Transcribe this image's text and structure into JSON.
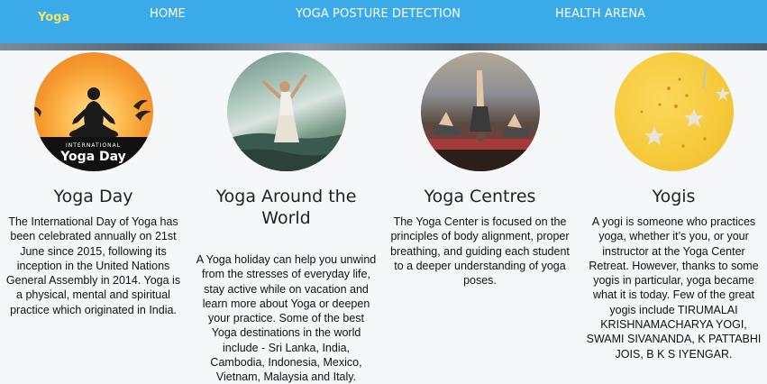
{
  "nav": {
    "brand": "Yoga",
    "links": [
      "HOME",
      "YOGA POSTURE DETECTION",
      "HEALTH ARENA"
    ]
  },
  "cards": [
    {
      "title": "Yoga Day",
      "image_icon": "yoga-day-image",
      "image_text_small": "INTERNATIONAL",
      "image_text_large": "Yoga Day",
      "text": "The International Day of Yoga has been celebrated annually on 21st June since 2015, following its inception in the United Nations General Assembly in 2014. Yoga is a physical, mental and spiritual practice which originated in India."
    },
    {
      "title": "Yoga Around the World",
      "image_icon": "yoga-world-image",
      "text": "A Yoga holiday can help you unwind from the stresses of everyday life, stay active while on vacation and learn more about Yoga or deepen your practice. Some of the best Yoga destinations in the world include - Sri Lanka, India, Cambodia, Indonesia, Mexico, Vietnam, Malaysia and Italy."
    },
    {
      "title": "Yoga Centres",
      "image_icon": "yoga-centres-image",
      "text": "The Yoga Center is focused on the principles of body alignment, proper breathing, and guiding each student to a deeper understanding of yoga poses."
    },
    {
      "title": "Yogis",
      "image_icon": "yogis-image",
      "text": "A yogi is someone who practices yoga, whether it’s you, or your instructor at the Yoga Center Retreat. However, thanks to some yogis in particular, yoga became what it is today. Few of the great yogis include TIRUMALAI KRISHNAMACHARYA YOGI, SWAMI SIVANANDA, K PATTABHI JOIS, B K S IYENGAR."
    }
  ],
  "colors": {
    "navbar": "#3aaae8",
    "brand": "#f3e36a",
    "nav_link": "#ffffff",
    "page_bg": "#f6f7f8"
  }
}
